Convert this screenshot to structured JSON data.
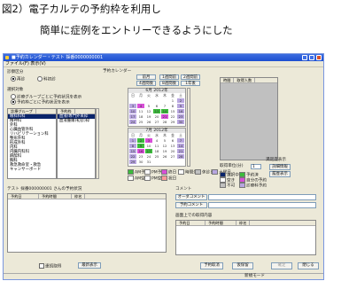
{
  "caption": {
    "line1": "図2）電子カルテの予約枠を利用し",
    "line2": "簡単に症例をエントリーできるようにした"
  },
  "window": {
    "title": "■予約カレンダー・テスト 採番0000000001",
    "menu": "ファイル(F) 表示(V)"
  },
  "left": {
    "kubun_label": "診察区分",
    "radio_saishin": "再診",
    "radio_kasoku": "科初診",
    "select_label": "選択対象",
    "opt1": "診療グループごとに予約状況を表示",
    "opt2": "予約枠ごとに予約状況を表示",
    "col_group": "診療グループ",
    "col_yoyaku": "予約枠",
    "groups": [
      "眼科科科",
      "精神科",
      "外科",
      "心臓血管外科",
      "リハビリテーション科",
      "整形外科",
      "形成外科",
      "内科",
      "内臓内科科",
      "麻酔科",
      "胸科",
      "救急救命室・救急",
      "キャンサーボード"
    ],
    "frames": [
      "血液/専門外来枠",
      "血液腫瘍(初診)枠"
    ]
  },
  "calendar": {
    "label": "予約カレンダー",
    "nav": [
      "前月",
      "1週間前",
      "2週間前",
      "4週間後",
      "8週間後",
      "1年後"
    ],
    "month1": "6月 2012年",
    "month2": "7月 2012年",
    "weekdays": [
      "日",
      "月",
      "火",
      "水",
      "木",
      "金",
      "土"
    ],
    "m1_days": [
      "",
      "",
      "",
      "",
      "",
      "1",
      "2",
      "3",
      "4",
      "5",
      "6",
      "7",
      "8",
      "9",
      "10",
      "11",
      "12",
      "13",
      "14",
      "15",
      "16",
      "17",
      "18",
      "19",
      "20",
      "21",
      "22",
      "23",
      "24",
      "25",
      "26",
      "27",
      "28",
      "29",
      "30"
    ],
    "m2_days": [
      "1",
      "2",
      "3",
      "4",
      "5",
      "6",
      "7",
      "8",
      "9",
      "10",
      "11",
      "12",
      "13",
      "14",
      "15",
      "16",
      "17",
      "18",
      "19",
      "20",
      "21",
      "22",
      "23",
      "24",
      "25",
      "26",
      "27",
      "28",
      "29",
      "30",
      "31"
    ],
    "legend": [
      "AM予約",
      "PM予約",
      "終日",
      "時間外",
      "休診日",
      "土曜日",
      "AM空",
      "PM空",
      "祝日"
    ]
  },
  "right": {
    "col_time": "時間",
    "col_count": "取得人数",
    "frame_label": "取得単位(分)",
    "frame_value": "1",
    "status_label": "満足度表示",
    "btn_detail": "詳細情報",
    "btn_history": "履歴表示",
    "legend": [
      "選択中",
      "予約済",
      "空き",
      "自分の予約",
      "不可",
      "診療科予約"
    ]
  },
  "bottom_left": {
    "title": "テスト 採番000000001 さんの予約状況",
    "cols": [
      "予約日",
      "予約時間",
      "枠名"
    ],
    "continuous_label": "連続取得",
    "btn_refresh": "最新表示"
  },
  "comment": {
    "label": "コメント",
    "btn_order": "オーダコメント",
    "btn_yoyaku": "予約コメント"
  },
  "bottom_right": {
    "title": "画面上での取得内容",
    "cols": [
      "予約日",
      "予約時間",
      "枠名"
    ],
    "btn_cancel": "予約取消",
    "btn_hold": "仮保留",
    "btn_confirm": "確定",
    "btn_close": "閉じる",
    "status": "新規モード"
  },
  "colors": {
    "green": "#3cbb3c",
    "magenta": "#d84fd8",
    "lavender": "#b8a6e0",
    "selected": "#0a246a",
    "titlebar": "#1d4fd0"
  }
}
